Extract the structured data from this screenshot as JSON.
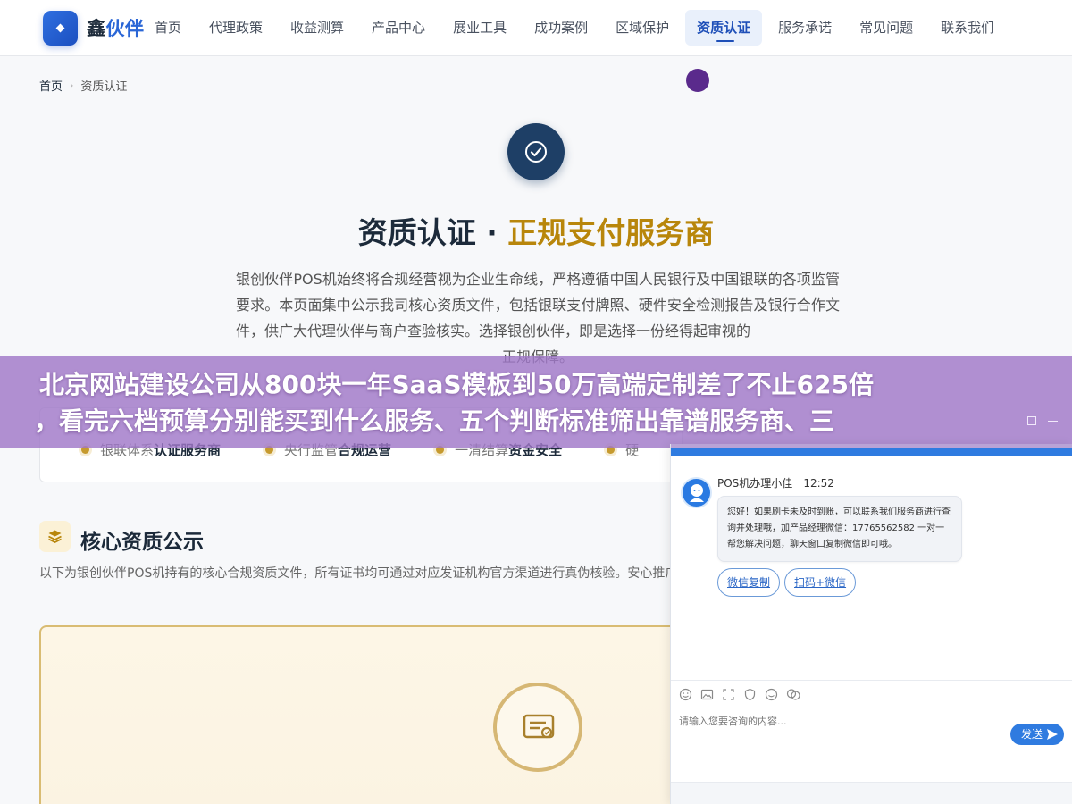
{
  "header": {
    "brand_part1": "鑫",
    "brand_part2": "伙伴",
    "nav": [
      {
        "label": "首页",
        "active": false
      },
      {
        "label": "代理政策",
        "active": false
      },
      {
        "label": "收益测算",
        "active": false
      },
      {
        "label": "产品中心",
        "active": false
      },
      {
        "label": "展业工具",
        "active": false
      },
      {
        "label": "成功案例",
        "active": false
      },
      {
        "label": "区域保护",
        "active": false
      },
      {
        "label": "资质认证",
        "active": true
      },
      {
        "label": "服务承诺",
        "active": false
      },
      {
        "label": "常见问题",
        "active": false
      },
      {
        "label": "联系我们",
        "active": false
      }
    ]
  },
  "breadcrumb": {
    "home": "首页",
    "separator": "›",
    "current": "资质认证"
  },
  "hero": {
    "title_main": "资质认证 · ",
    "title_accent": "正规支付服务商",
    "description": "银创伙伴POS机始终将合规经营视为企业生命线，严格遵循中国人民银行及中国银联的各项监管要求。本页面集中公示我司核心资质文件，包括银联支付牌照、硬件安全检测报告及银行合作文件，供广大代理伙伴与商户查验核实。选择银创伙伴，即是选择一份经得起审视的",
    "description_last": "正规保障。"
  },
  "features": [
    {
      "muted": "银联体系",
      "strong": "认证服务商"
    },
    {
      "muted": "央行监管",
      "strong": "合规运营"
    },
    {
      "muted": "一清结算",
      "strong": "资金安全"
    },
    {
      "muted": "硬",
      "strong": ""
    }
  ],
  "core": {
    "title": "核心资质公示",
    "description": "以下为银创伙伴POS机持有的核心合规资质文件，所有证书均可通过对应发证机构官方渠道进行真伪核验。安心推广。"
  },
  "banner": {
    "line1": "北京网站建设公司从800块一年SaaS模板到50万高端定制差了不止625倍",
    "line2": "，看完六档预算分别能买到什么服务、五个判断标准筛出靠谱服务商、三"
  },
  "chat": {
    "agent_name": "POS机办理小佳",
    "time": "12:52",
    "message": "您好！如果刷卡未及时到账，可以联系我们服务商进行查询并处理哦，加产品经理微信：17765562582 一对一帮您解决问题，聊天窗口复制微信即可哦。",
    "quick_buttons": [
      "微信复制",
      "扫码+微信"
    ],
    "input_placeholder": "请输入您要咨询的内容...",
    "send_label": "发送",
    "tools": [
      "smile-icon",
      "image-icon",
      "screenshot-icon",
      "shield-icon",
      "emoji-icon",
      "chat-bubbles-icon"
    ]
  },
  "colors": {
    "brand_blue": "#2a66d6",
    "navy": "#1e3f66",
    "gold": "#b8860b",
    "banner_purple": "#a078c8",
    "chat_blue": "#2f7be0"
  }
}
